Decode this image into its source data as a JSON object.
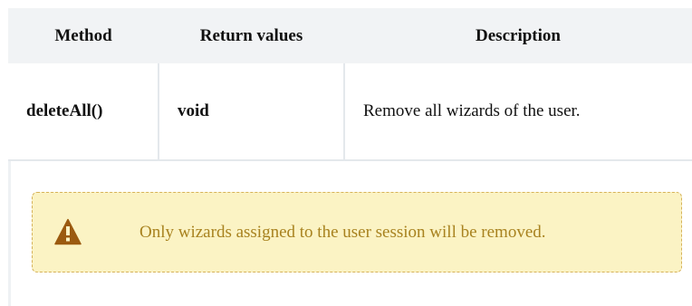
{
  "table": {
    "headers": {
      "method": "Method",
      "return_values": "Return values",
      "description": "Description"
    },
    "rows": [
      {
        "method": "deleteAll()",
        "return_value": "void",
        "description": "Remove all wizards of the user."
      }
    ]
  },
  "warning": {
    "icon": "warning-triangle-icon",
    "text": "Only wizards assigned to the user session will be removed.",
    "colors": {
      "background": "#fbf3c4",
      "border": "#d6b25a",
      "text": "#a8821f",
      "icon": "#9b5a10"
    }
  },
  "colors": {
    "header_background": "#f1f3f5",
    "divider": "#e4e8ec"
  }
}
